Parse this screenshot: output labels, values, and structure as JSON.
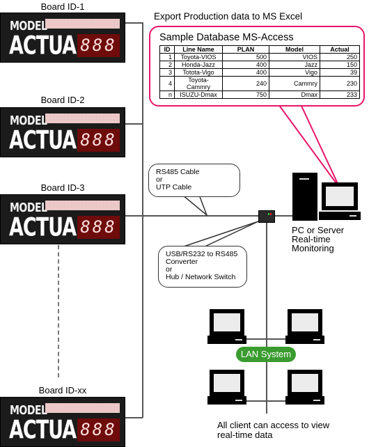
{
  "boards": [
    {
      "label": "Board ID-1",
      "model": "MODEL",
      "actual": "ACTUAL",
      "digits": "888"
    },
    {
      "label": "Board ID-2",
      "model": "MODEL",
      "actual": "ACTUAL",
      "digits": "888"
    },
    {
      "label": "Board ID-3",
      "model": "MODEL",
      "actual": "ACTUAL",
      "digits": "888"
    },
    {
      "label": "Board ID-xx",
      "model": "MODEL",
      "actual": "ACTUAL",
      "digits": "888"
    }
  ],
  "export_title": "Export Production data to MS Excel",
  "database": {
    "title": "Sample Database MS-Access",
    "columns": [
      "ID",
      "Line Name",
      "PLAN",
      "Model",
      "Actual"
    ],
    "rows": [
      [
        "1",
        "Toyota-VIOS",
        "500",
        "VIOS",
        "250"
      ],
      [
        "2",
        "Honda-Jazz",
        "400",
        "Jazz",
        "150"
      ],
      [
        "3",
        "Totota-Vigo",
        "400",
        "Vigo",
        "39"
      ],
      [
        "4",
        "Toyota-Cammry",
        "240",
        "Cammry",
        "230"
      ],
      [
        "n",
        "ISUZU-Dmax",
        "750",
        "Dmax",
        "233"
      ]
    ]
  },
  "cable_bubble": {
    "line1": "RS485 Cable",
    "line2": "or",
    "line3": "UTP Cable"
  },
  "converter_bubble": {
    "line1": "USB/RS232 to RS485",
    "line2": "Converter",
    "line3": "or",
    "line4": "Hub / Network Switch"
  },
  "server": {
    "line1": "PC or Server",
    "line2": "Real-time Monitoring"
  },
  "lan_label": "LAN System",
  "clients_caption": {
    "line1": "All client can access to view",
    "line2": "real-time data"
  },
  "colors": {
    "accent_pink": "#e8156a",
    "lan_green": "#3a9b2f",
    "board_bg": "#1b1b1b",
    "digit_bg": "#6e0b0b"
  }
}
